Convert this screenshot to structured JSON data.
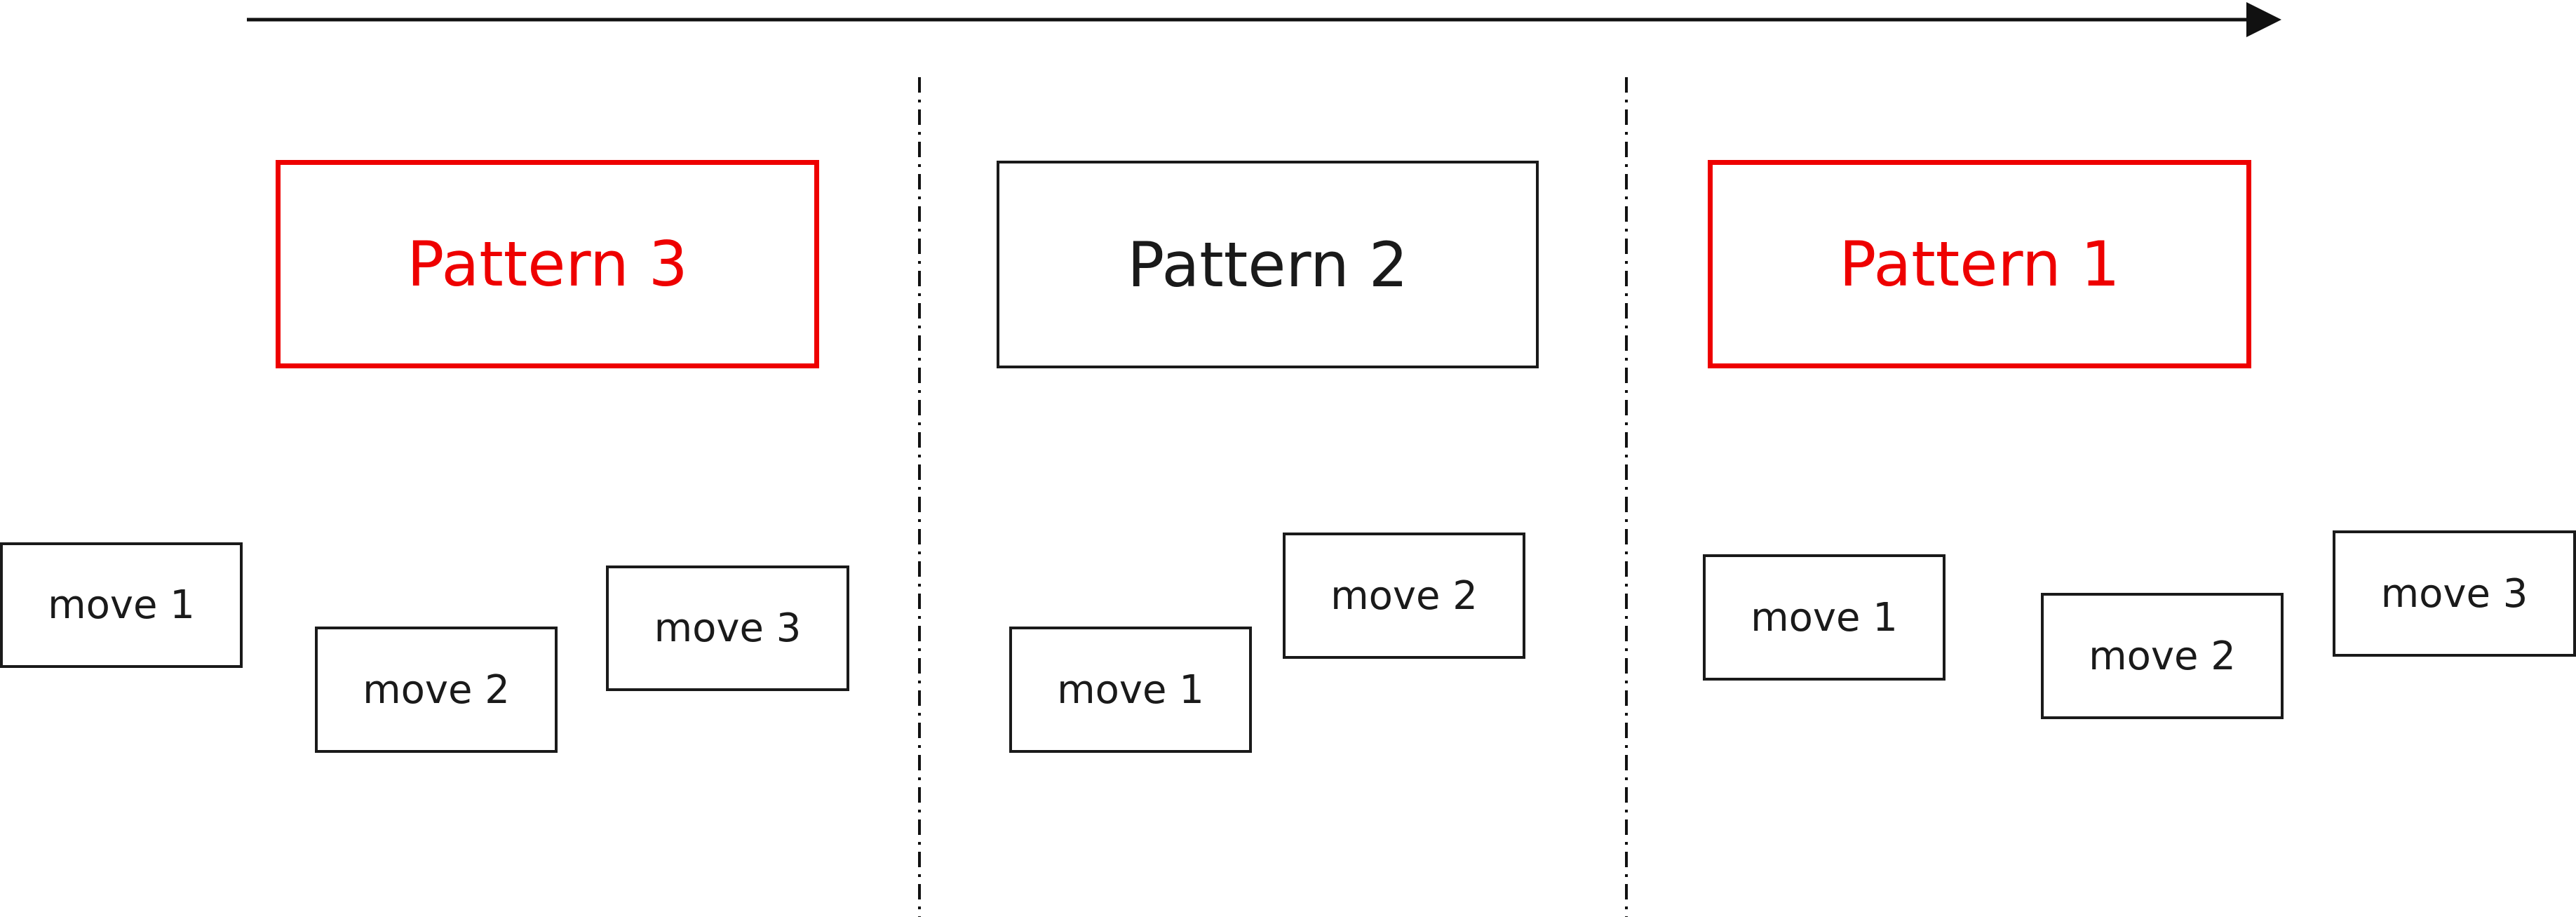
{
  "accent_color": "#ee0000",
  "patterns": [
    {
      "label": "Pattern 3",
      "highlighted": true
    },
    {
      "label": "Pattern 2",
      "highlighted": false
    },
    {
      "label": "Pattern 1",
      "highlighted": true
    }
  ],
  "groups": [
    {
      "moves": [
        "move 1",
        "move 2",
        "move 3"
      ]
    },
    {
      "moves": [
        "move 1",
        "move 2"
      ]
    },
    {
      "moves": [
        "move 1",
        "move 2",
        "move 3"
      ]
    }
  ]
}
